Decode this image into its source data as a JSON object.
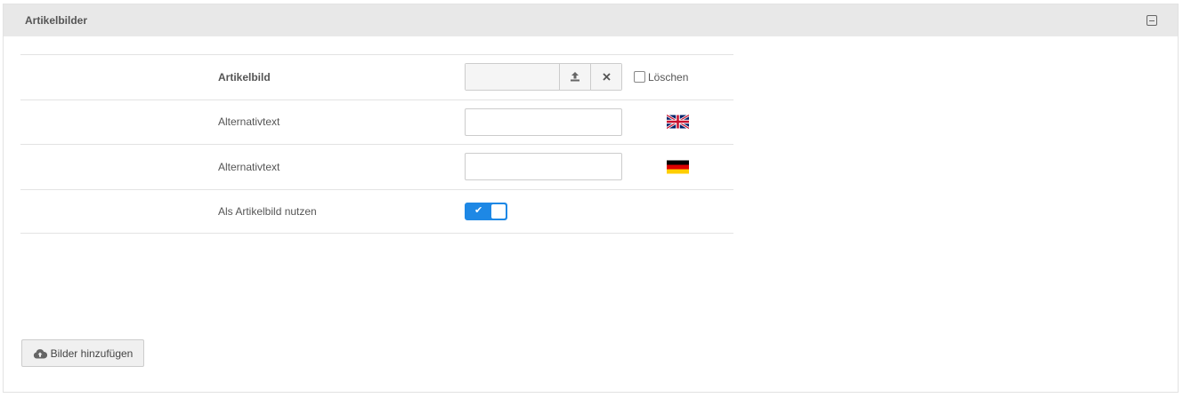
{
  "panel": {
    "title": "Artikelbilder"
  },
  "rows": {
    "image": {
      "label": "Artikelbild",
      "upload_icon": "upload-icon",
      "remove_icon": "close-icon",
      "delete_label": "Löschen",
      "delete_checked": false
    },
    "alt_en": {
      "label": "Alternativtext",
      "value": "",
      "flag": "uk-flag-icon"
    },
    "alt_de": {
      "label": "Alternativtext",
      "value": "",
      "flag": "germany-flag-icon"
    },
    "use_as_main": {
      "label": "Als Artikelbild nutzen",
      "enabled": true,
      "check_glyph": "✔"
    }
  },
  "add_button": {
    "label": "Bilder hinzufügen",
    "icon": "cloud-upload-icon"
  },
  "colors": {
    "accent": "#1e88e5",
    "header_bg": "#e8e8e8"
  }
}
